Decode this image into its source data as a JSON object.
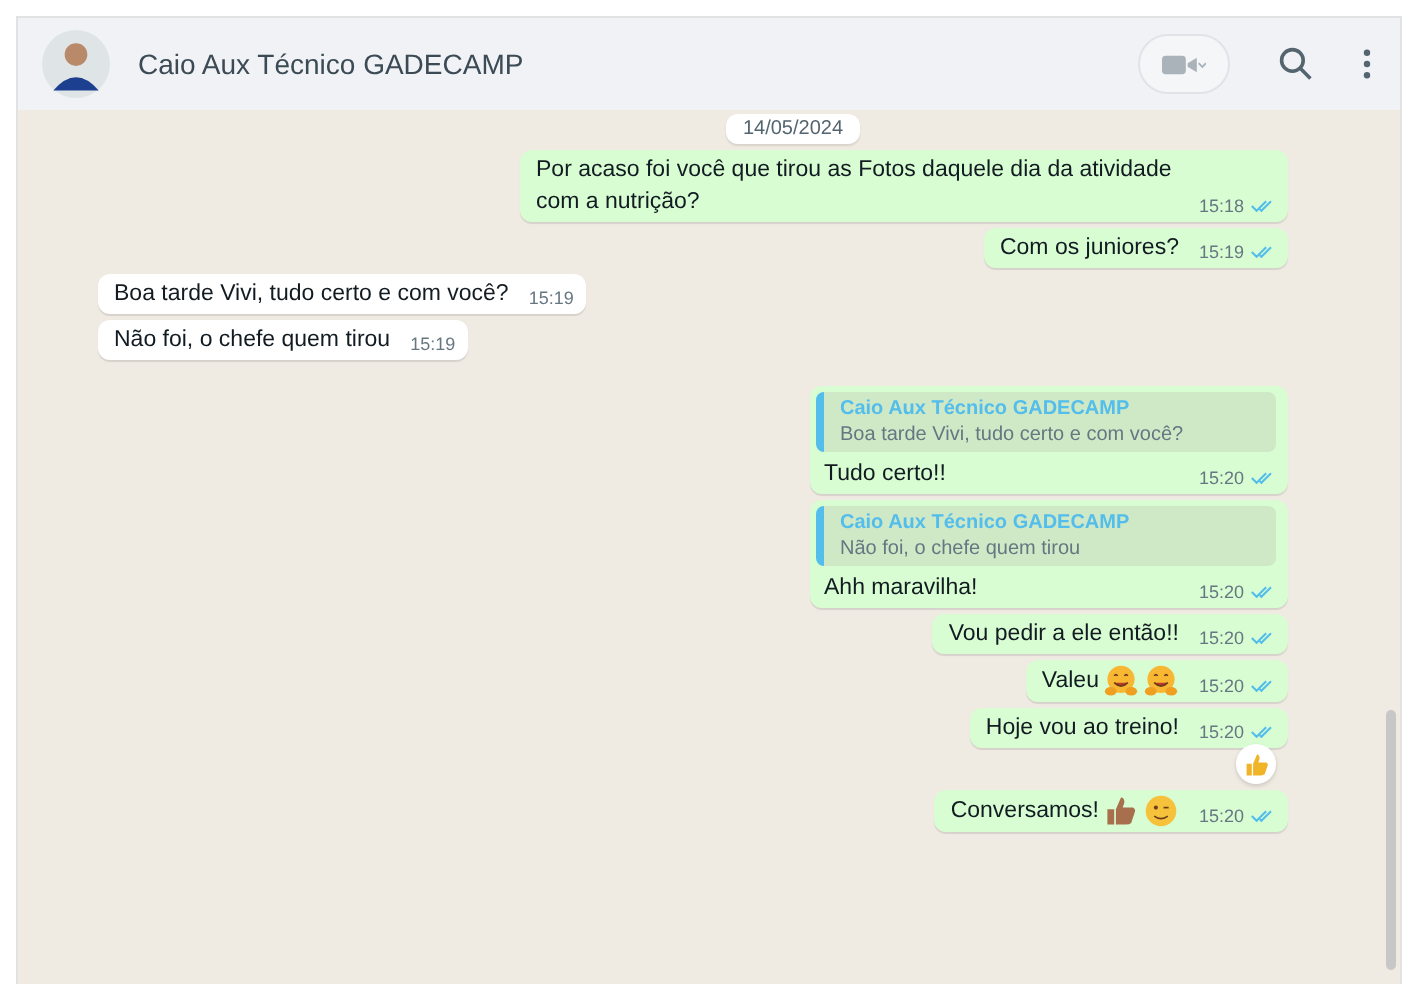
{
  "header": {
    "contact_name": "Caio Aux Técnico GADECAMP"
  },
  "date_chip": "14/05/2024",
  "messages": [
    {
      "kind": "outgoing",
      "text": "Por acaso foi você que tirou as Fotos daquele dia da atividade com a nutrição?",
      "time": "15:18",
      "read": true
    },
    {
      "kind": "outgoing",
      "text": "Com os juniores?",
      "time": "15:19",
      "read": true
    },
    {
      "kind": "incoming",
      "text": "Boa tarde Vivi, tudo certo e com você?",
      "time": "15:19"
    },
    {
      "kind": "incoming",
      "text": "Não foi, o chefe quem tirou",
      "time": "15:19"
    },
    {
      "kind": "outgoing",
      "quote": {
        "author": "Caio Aux Técnico GADECAMP",
        "text": "Boa tarde Vivi, tudo certo e com você?"
      },
      "text": "Tudo certo!!",
      "time": "15:20",
      "read": true
    },
    {
      "kind": "outgoing",
      "quote": {
        "author": "Caio Aux Técnico GADECAMP",
        "text": "Não foi, o chefe quem tirou"
      },
      "text": "Ahh maravilha!",
      "time": "15:20",
      "read": true
    },
    {
      "kind": "outgoing",
      "text": "Vou pedir a ele então!!",
      "time": "15:20",
      "read": true
    },
    {
      "kind": "outgoing",
      "text": "Valeu",
      "emojis": [
        {
          "kind": "hug"
        },
        {
          "kind": "hug"
        }
      ],
      "time": "15:20",
      "read": true
    },
    {
      "kind": "outgoing",
      "text": "Hoje vou ao treino!",
      "time": "15:20",
      "read": true,
      "reaction": {
        "kind": "thumbs-up"
      }
    },
    {
      "kind": "outgoing",
      "text": "Conversamos!",
      "emojis": [
        {
          "kind": "thumbs-up"
        },
        {
          "kind": "wink"
        }
      ],
      "time": "15:20",
      "read": true
    }
  ]
}
